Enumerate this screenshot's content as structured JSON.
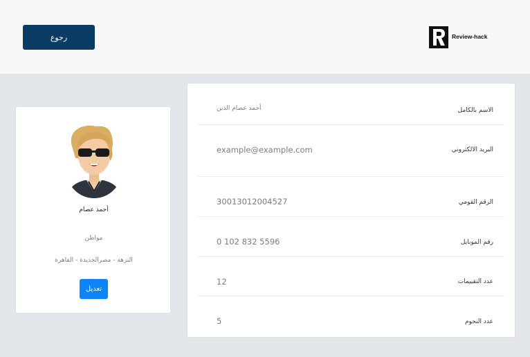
{
  "header": {
    "back_label": "رجوع",
    "brand_name": "Review-hack"
  },
  "profile": {
    "name": "أحمد عصام",
    "role": "مواطن",
    "address": "النزهة - مصرالجديدة - القاهرة",
    "edit_label": "تعديل"
  },
  "details": [
    {
      "label": "الاسم بالكامل",
      "value": "أحمد عصام الدين"
    },
    {
      "label": "البريد الالكتروني",
      "value": "example@example.com"
    },
    {
      "label": "الرقم القومي",
      "value": "30013012004527"
    },
    {
      "label": "رقم الموبايل",
      "value": "0 102 832 5596"
    },
    {
      "label": "عدد التقييمات",
      "value": "12"
    },
    {
      "label": "عدد النجوم",
      "value": "5"
    }
  ],
  "colors": {
    "primary_dark": "#0b3c66",
    "accent": "#0d84f8"
  }
}
